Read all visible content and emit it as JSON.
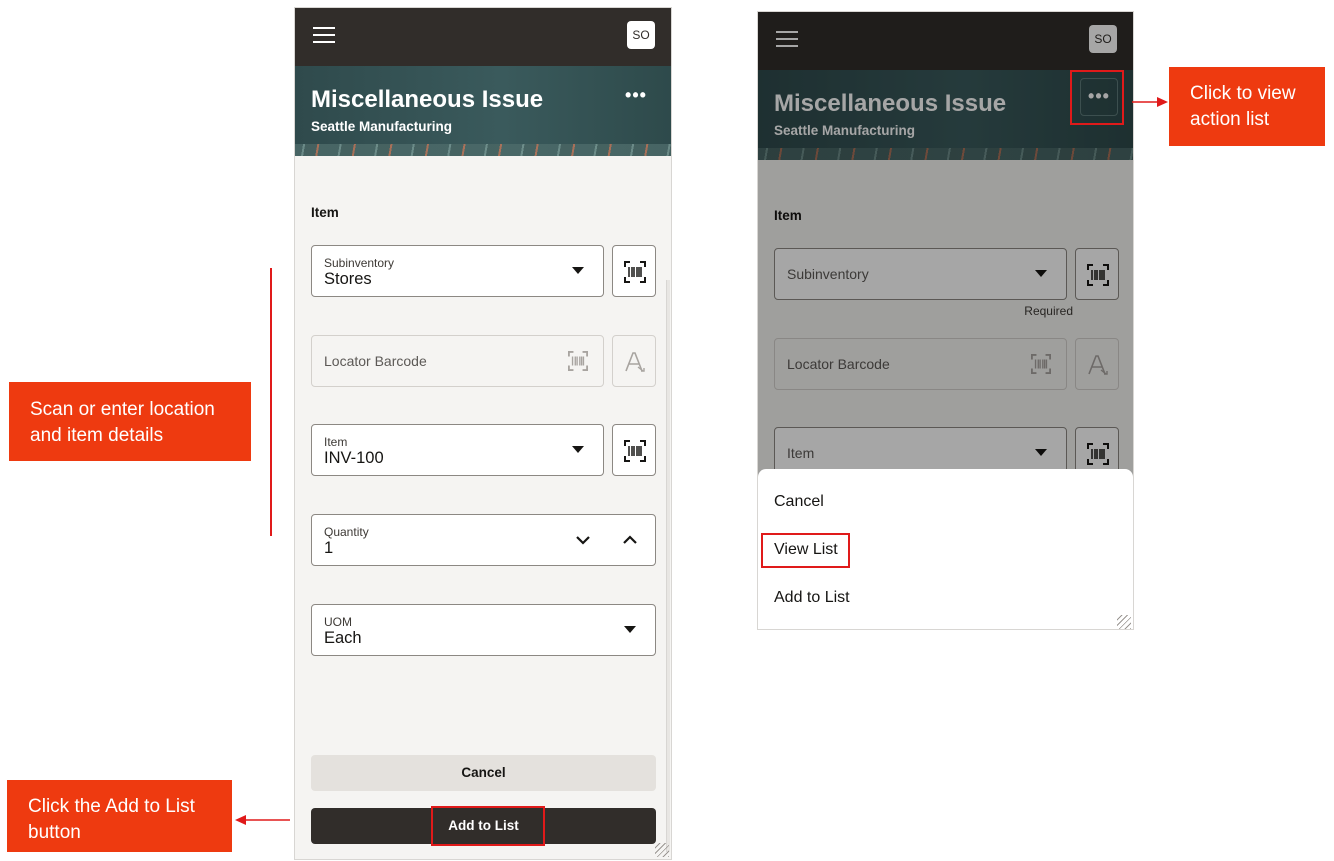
{
  "left_screen": {
    "avatar": "SO",
    "title": "Miscellaneous Issue",
    "subtitle": "Seattle Manufacturing",
    "overflow_label": "•••",
    "section_label": "Item",
    "subinventory": {
      "label": "Subinventory",
      "value": "Stores"
    },
    "locator": {
      "placeholder": "Locator Barcode"
    },
    "item": {
      "label": "Item",
      "value": "INV-100"
    },
    "quantity": {
      "label": "Quantity",
      "value": "1"
    },
    "uom": {
      "label": "UOM",
      "value": "Each"
    },
    "cancel_label": "Cancel",
    "add_label": "Add to List"
  },
  "right_screen": {
    "avatar": "SO",
    "title": "Miscellaneous Issue",
    "subtitle": "Seattle Manufacturing",
    "overflow_label": "•••",
    "section_label": "Item",
    "subinventory_placeholder": "Subinventory",
    "required_text": "Required",
    "locator_placeholder": "Locator Barcode",
    "item_placeholder": "Item",
    "action_list": [
      "Cancel",
      "View List",
      "Add to List"
    ]
  },
  "callouts": {
    "scan": "Scan or enter location and item details",
    "add": "Click the Add to List button",
    "action": "Click to view action list"
  },
  "colors": {
    "header": "#312d2a",
    "banner": "#3a5a5c",
    "callout": "#ee3a10",
    "highlight": "#e01a1a"
  }
}
